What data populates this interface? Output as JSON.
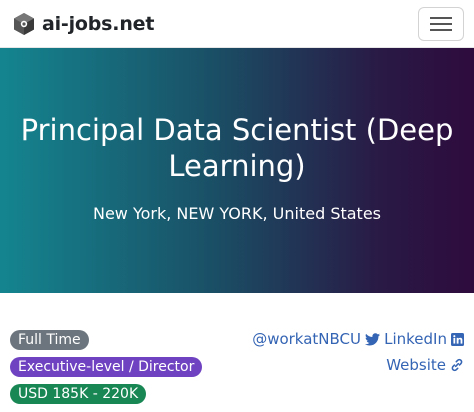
{
  "brand": {
    "name": "ai-jobs.net"
  },
  "navbar": {
    "menu_icon": "hamburger-menu-icon"
  },
  "hero": {
    "title": "Principal Data Scientist (Deep Learning)",
    "location": "New York, NEW YORK, United States",
    "gradient": [
      "#14858f",
      "#1a4f66",
      "#291a45",
      "#2e0b3d"
    ]
  },
  "badges": {
    "employment_type": "Full Time",
    "level": "Executive-level / Director",
    "salary": "USD 185K - 220K"
  },
  "links": {
    "twitter": {
      "label": "@workatNBCU",
      "icon": "twitter-icon"
    },
    "linkedin": {
      "label": "LinkedIn",
      "icon": "linkedin-icon"
    },
    "website": {
      "label": "Website",
      "icon": "link-icon"
    }
  },
  "colors": {
    "link": "#3464b4",
    "badge_gray": "#6c757d",
    "badge_purple": "#6f42c1",
    "badge_green": "#198754"
  }
}
